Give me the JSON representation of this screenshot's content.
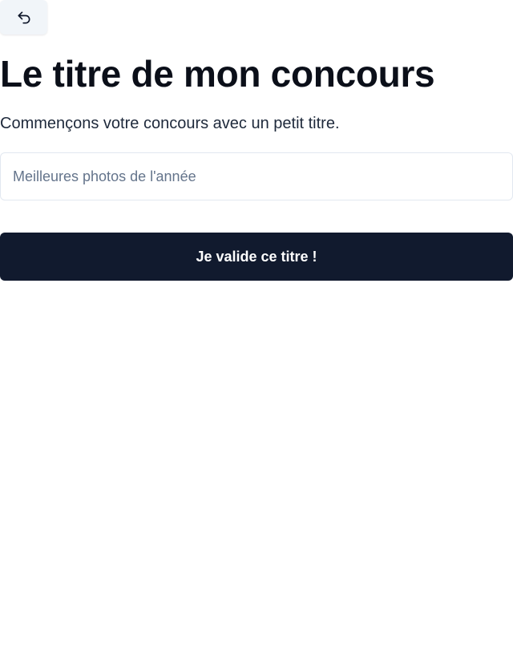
{
  "header": {
    "back_icon": "undo-icon"
  },
  "main": {
    "title": "Le titre de mon concours",
    "subtitle": "Commençons votre concours avec un petit titre.",
    "title_input": {
      "value": "",
      "placeholder": "Meilleures photos de l'année"
    },
    "submit_label": "Je valide ce titre !"
  },
  "colors": {
    "background": "#ffffff",
    "primary_button": "#111a2e",
    "primary_button_text": "#ffffff",
    "back_button_bg": "#f1f5f9",
    "input_border": "#e2e8f0",
    "placeholder_text": "#64748b",
    "heading_text": "#0b0f19"
  }
}
